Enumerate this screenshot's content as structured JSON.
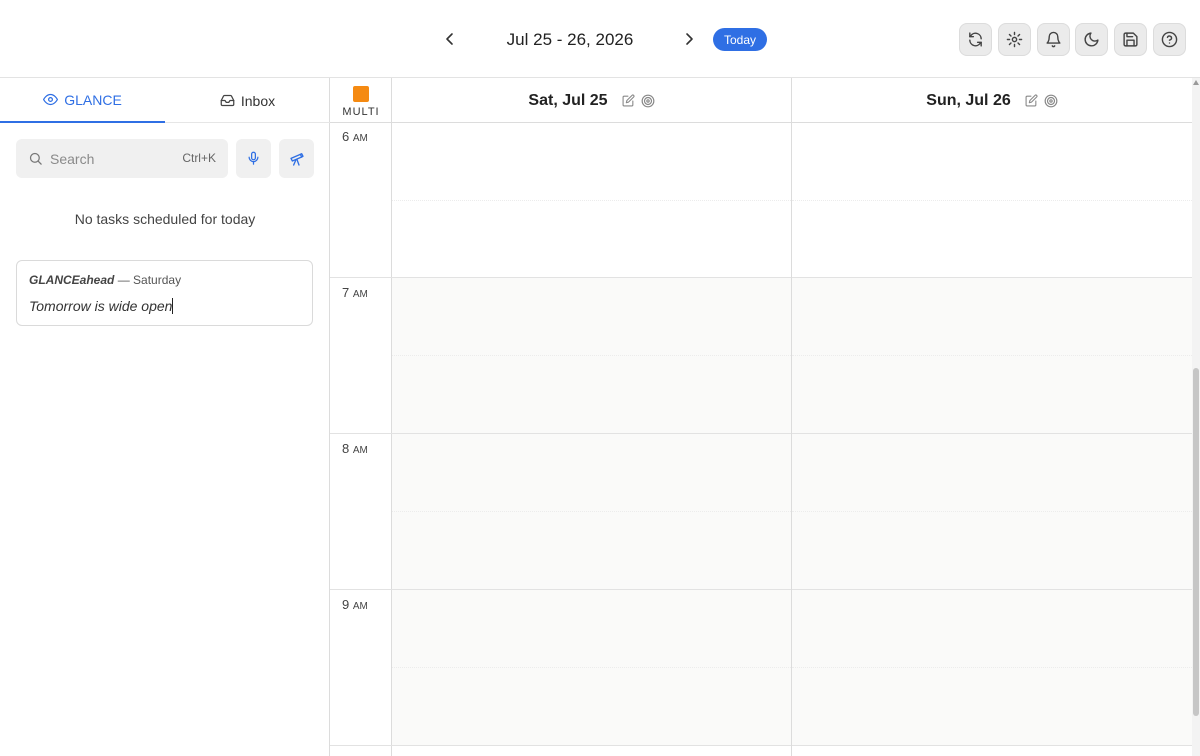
{
  "header": {
    "date_range": "Jul 25 - 26, 2026",
    "today_label": "Today",
    "tools": [
      {
        "icon": "sync-icon"
      },
      {
        "icon": "gear-icon"
      },
      {
        "icon": "bell-icon"
      },
      {
        "icon": "moon-icon"
      },
      {
        "icon": "save-icon"
      },
      {
        "icon": "help-icon"
      }
    ]
  },
  "sidebar": {
    "tabs": [
      {
        "label": "GLANCE",
        "icon": "eye-icon",
        "active": true
      },
      {
        "label": "Inbox",
        "icon": "inbox-icon",
        "active": false
      }
    ],
    "search": {
      "placeholder": "Search",
      "shortcut": "Ctrl+K"
    },
    "empty_message": "No tasks scheduled for today",
    "ahead": {
      "brand": "GLANCEahead",
      "day": "— Saturday",
      "text": "Tomorrow is wide open"
    }
  },
  "calendar": {
    "multi_label": "MULTI",
    "accent": "#f58a12",
    "days": [
      {
        "label": "Sat, Jul 25"
      },
      {
        "label": "Sun, Jul 26"
      }
    ],
    "hours": [
      {
        "num": "6",
        "suffix": "AM"
      },
      {
        "num": "7",
        "suffix": "AM"
      },
      {
        "num": "8",
        "suffix": "AM"
      },
      {
        "num": "9",
        "suffix": "AM"
      }
    ]
  },
  "colors": {
    "primary": "#2f6fe4"
  }
}
